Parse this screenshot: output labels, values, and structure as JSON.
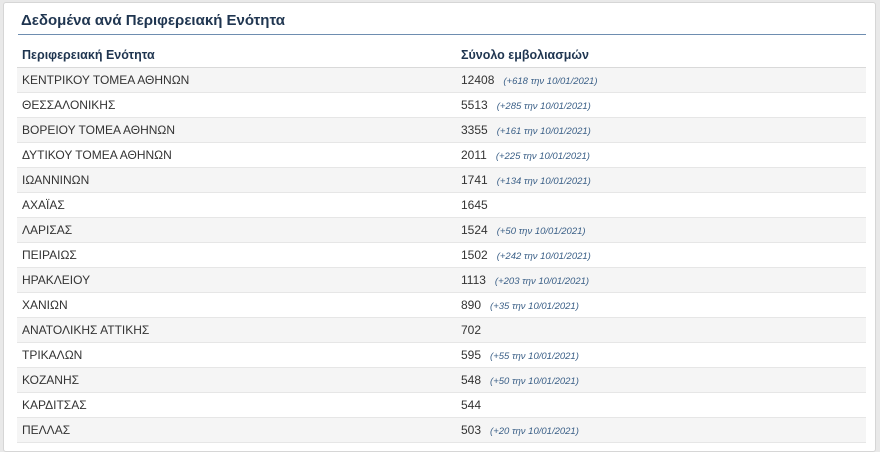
{
  "panel": {
    "title": "Δεδομένα ανά Περιφερειακή Ενότητα"
  },
  "table": {
    "headers": [
      "Περιφερειακή Ενότητα",
      "Σύνολο εμβολιασμών"
    ],
    "rows": [
      {
        "region": "ΚΕΝΤΡΙΚΟΥ ΤΟΜΕΑ ΑΘΗΝΩΝ",
        "total": "12408",
        "delta": "(+618 την 10/01/2021)"
      },
      {
        "region": "ΘΕΣΣΑΛΟΝΙΚΗΣ",
        "total": "5513",
        "delta": "(+285 την 10/01/2021)"
      },
      {
        "region": "ΒΟΡΕΙΟΥ ΤΟΜΕΑ ΑΘΗΝΩΝ",
        "total": "3355",
        "delta": "(+161 την 10/01/2021)"
      },
      {
        "region": "ΔΥΤΙΚΟΥ ΤΟΜΕΑ ΑΘΗΝΩΝ",
        "total": "2011",
        "delta": "(+225 την 10/01/2021)"
      },
      {
        "region": "ΙΩΑΝΝΙΝΩΝ",
        "total": "1741",
        "delta": "(+134 την 10/01/2021)"
      },
      {
        "region": "ΑΧΑΪΑΣ",
        "total": "1645",
        "delta": ""
      },
      {
        "region": "ΛΑΡΙΣΑΣ",
        "total": "1524",
        "delta": "(+50 την 10/01/2021)"
      },
      {
        "region": "ΠΕΙΡΑΙΩΣ",
        "total": "1502",
        "delta": "(+242 την 10/01/2021)"
      },
      {
        "region": "ΗΡΑΚΛΕΙΟΥ",
        "total": "1113",
        "delta": "(+203 την 10/01/2021)"
      },
      {
        "region": "ΧΑΝΙΩΝ",
        "total": "890",
        "delta": "(+35 την 10/01/2021)"
      },
      {
        "region": "ΑΝΑΤΟΛΙΚΗΣ ΑΤΤΙΚΗΣ",
        "total": "702",
        "delta": ""
      },
      {
        "region": "ΤΡΙΚΑΛΩΝ",
        "total": "595",
        "delta": "(+55 την 10/01/2021)"
      },
      {
        "region": "ΚΟΖΑΝΗΣ",
        "total": "548",
        "delta": "(+50 την 10/01/2021)"
      },
      {
        "region": "ΚΑΡΔΙΤΣΑΣ",
        "total": "544",
        "delta": ""
      },
      {
        "region": "ΠΕΛΛΑΣ",
        "total": "503",
        "delta": "(+20 την 10/01/2021)"
      }
    ]
  },
  "colors": {
    "title": "#1f3550",
    "delta": "#3a5f87",
    "stripe": "#f5f5f5"
  }
}
